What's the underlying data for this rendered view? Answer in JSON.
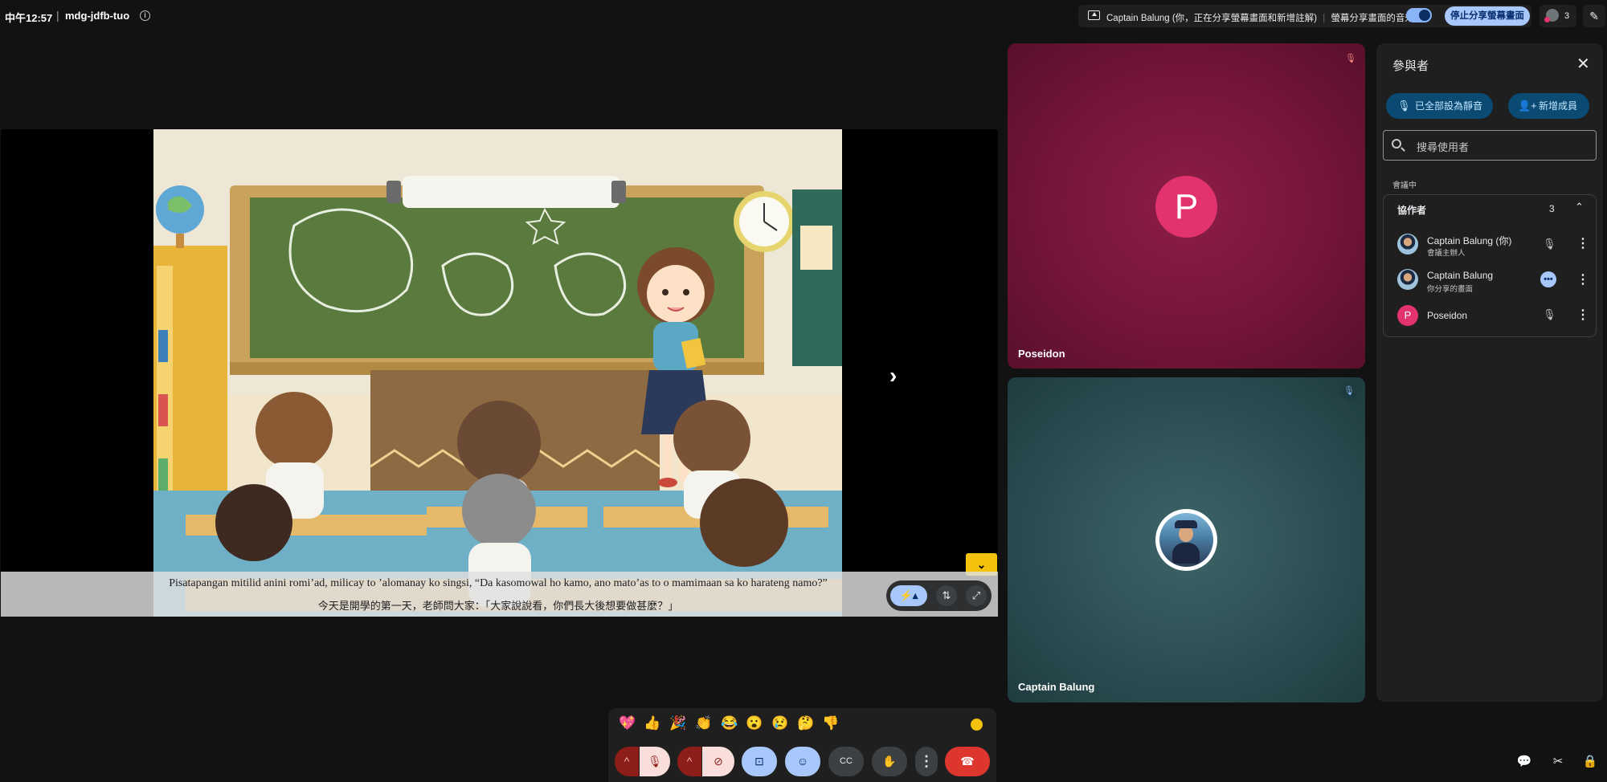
{
  "meeting": {
    "time": "中午12:57",
    "separator": "|",
    "code": "mdg-jdfb-tuo",
    "info_icon": "i"
  },
  "topbar": {
    "sharing_text": "Captain Balung (你，正在分享螢幕畫面和新增註解)",
    "divider": "|",
    "audio_label": "螢幕分享畫面的音效",
    "stop_button": "停止分享螢幕畫面",
    "participant_count": "3",
    "annotate_icon": "✎"
  },
  "presentation": {
    "next_icon": "›",
    "collapse_icon": "⌄",
    "subtitle_line1": "Pisatapangan mitilid anini romi’ad, milicay to ’alomanay ko singsi, “Da kasomowal ho kamo, ano mato’as to o mamimaan sa ko harateng namo?”",
    "subtitle_line2": "今天是開學的第一天，老師問大家：「大家說說看，你們長大後想要做甚麼？」",
    "controls": {
      "main_icon": "⚡▴",
      "swap_icon": "⇅",
      "expand_icon": "⤢"
    }
  },
  "tiles": [
    {
      "name": "Poseidon",
      "initial": "P",
      "mute_icon": "🎙"
    },
    {
      "name": "Captain Balung",
      "mute_icon": "🎙"
    }
  ],
  "panel": {
    "title": "參與者",
    "close_icon": "✕",
    "mute_all": "已全部設為靜音",
    "mute_all_icon": "🎙",
    "add_member": "新增成員",
    "add_icon": "👤+",
    "search_placeholder": "搜尋使用者",
    "section_label": "會議中",
    "group": {
      "name": "協作者",
      "count": "3",
      "chevron": "⌃"
    },
    "participants": [
      {
        "name": "Captain Balung (你)",
        "sub": "會議主辦人"
      },
      {
        "name": "Captain Balung",
        "sub": "你分享的畫面"
      },
      {
        "name": "Poseidon",
        "sub": "",
        "initial": "P"
      }
    ],
    "more_icon": "⋮",
    "mic_off_icon": "🎙",
    "ellipsis_icon": "•••"
  },
  "reactions": [
    "💖",
    "👍",
    "🎉",
    "👏",
    "😂",
    "😮",
    "😢",
    "🤔",
    "👎"
  ],
  "controls": {
    "mic_chevron": "^",
    "mic_icon": "🎙",
    "cam_chevron": "^",
    "cam_icon": "⊘",
    "present_icon": "⊡",
    "emoji_icon": "☺",
    "captions_icon": "CC",
    "hand_icon": "✋",
    "more_icon": "⋮",
    "end_icon": "☎"
  },
  "bottom_right": {
    "chat_icon": "💬",
    "tools_icon": "✂",
    "lock_icon": "🔒"
  }
}
